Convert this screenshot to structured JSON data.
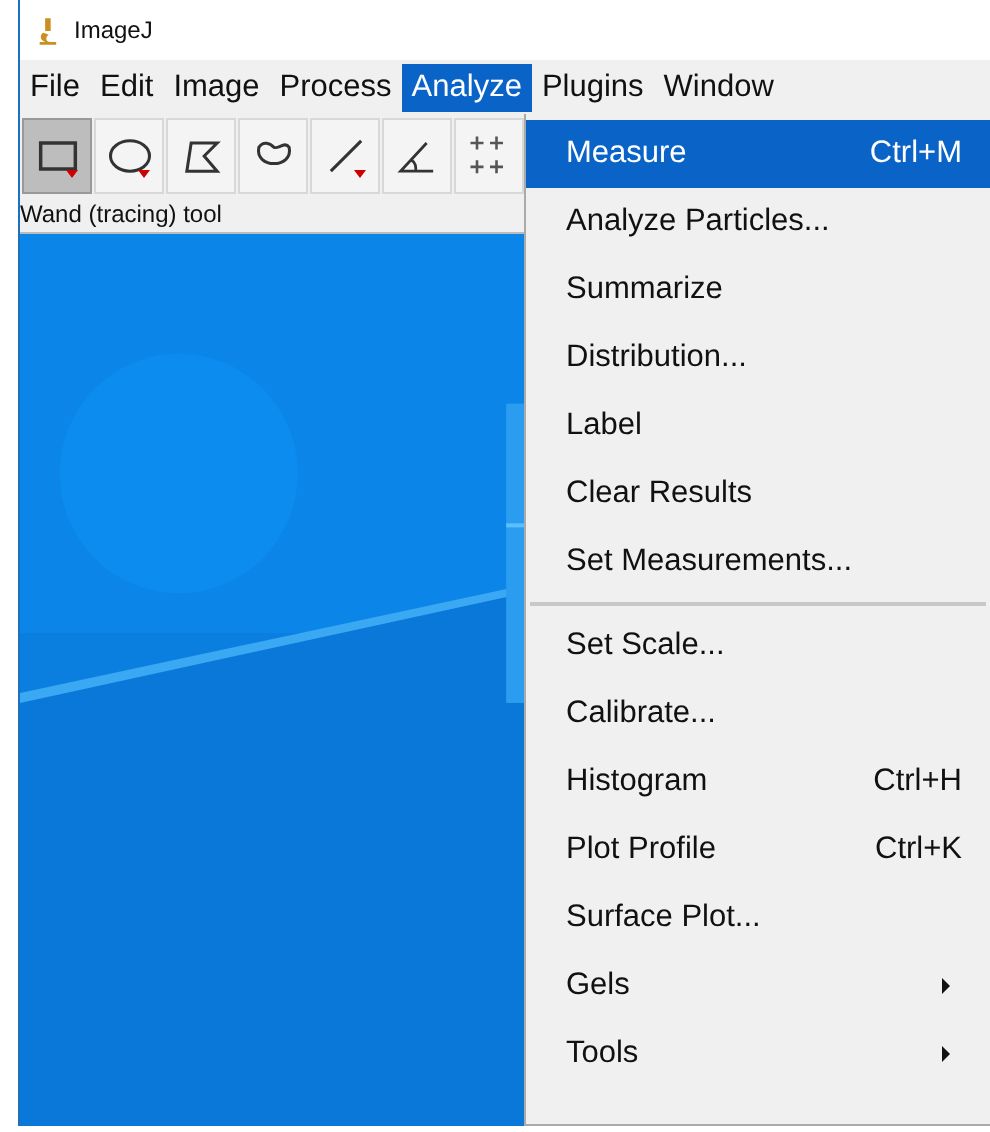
{
  "window": {
    "title": "ImageJ"
  },
  "menu_bar": [
    {
      "label": "File",
      "selected": false
    },
    {
      "label": "Edit",
      "selected": false
    },
    {
      "label": "Image",
      "selected": false
    },
    {
      "label": "Process",
      "selected": false
    },
    {
      "label": "Analyze",
      "selected": true
    },
    {
      "label": "Plugins",
      "selected": false
    },
    {
      "label": "Window",
      "selected": false
    }
  ],
  "toolbar": [
    {
      "kind": "rectangle",
      "selected": true,
      "options": true
    },
    {
      "kind": "oval",
      "selected": false,
      "options": true
    },
    {
      "kind": "polygon",
      "selected": false,
      "options": false
    },
    {
      "kind": "freehand",
      "selected": false,
      "options": false
    },
    {
      "kind": "line",
      "selected": false,
      "options": true
    },
    {
      "kind": "angle",
      "selected": false,
      "options": false
    },
    {
      "kind": "points",
      "selected": false,
      "options": false
    }
  ],
  "status_bar": "Wand (tracing) tool",
  "menu": {
    "groups": [
      [
        {
          "label": "Measure",
          "shortcut": "Ctrl+M",
          "selected": true,
          "submenu": false
        },
        {
          "label": "Analyze Particles...",
          "selected": false,
          "submenu": false
        },
        {
          "label": "Summarize",
          "selected": false,
          "submenu": false
        },
        {
          "label": "Distribution...",
          "selected": false,
          "submenu": false
        },
        {
          "label": "Label",
          "selected": false,
          "submenu": false
        },
        {
          "label": "Clear Results",
          "selected": false,
          "submenu": false
        },
        {
          "label": "Set Measurements...",
          "selected": false,
          "submenu": false
        }
      ],
      [
        {
          "label": "Set Scale...",
          "selected": false,
          "submenu": false
        },
        {
          "label": "Calibrate...",
          "selected": false,
          "submenu": false
        },
        {
          "label": "Histogram",
          "shortcut": "Ctrl+H",
          "selected": false,
          "submenu": false
        },
        {
          "label": "Plot Profile",
          "shortcut": "Ctrl+K",
          "selected": false,
          "submenu": false
        },
        {
          "label": "Surface Plot...",
          "selected": false,
          "submenu": false
        },
        {
          "label": "Gels",
          "selected": false,
          "submenu": true
        },
        {
          "label": "Tools",
          "selected": false,
          "submenu": true
        }
      ]
    ]
  }
}
